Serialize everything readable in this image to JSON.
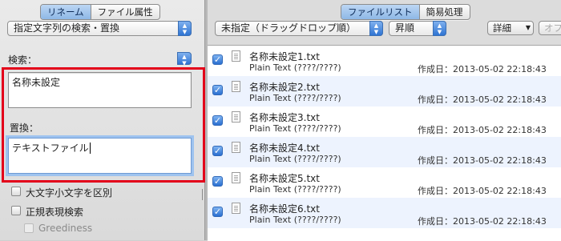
{
  "left": {
    "tabs": [
      "リネーム",
      "ファイル属性"
    ],
    "mode_popup": "指定文字列の検索・置換",
    "search_label": "検索：",
    "search_value": "名称未設定",
    "replace_label": "置換：",
    "replace_value": "テキストファイル",
    "checkboxes": {
      "case": "大文字小文字を区別",
      "regex": "正規表現検索",
      "greedy": "Greediness"
    }
  },
  "right": {
    "tabs": [
      "ファイルリスト",
      "簡易処理"
    ],
    "sort_popup": "未指定（ドラッグドロップ順）",
    "order_popup": "昇順",
    "detail_button": "詳細",
    "off_button": "オフ",
    "files": [
      {
        "name": "名称未設定1.txt",
        "type": "Plain Text (????/????)",
        "date": "作成日：2013-05-02 22:18:43"
      },
      {
        "name": "名称未設定2.txt",
        "type": "Plain Text (????/????)",
        "date": "作成日：2013-05-02 22:18:43"
      },
      {
        "name": "名称未設定3.txt",
        "type": "Plain Text (????/????)",
        "date": "作成日：2013-05-02 22:18:43"
      },
      {
        "name": "名称未設定4.txt",
        "type": "Plain Text (????/????)",
        "date": "作成日：2013-05-02 22:18:43"
      },
      {
        "name": "名称未設定5.txt",
        "type": "Plain Text (????/????)",
        "date": "作成日：2013-05-02 22:18:43"
      },
      {
        "name": "名称未設定6.txt",
        "type": "Plain Text (????/????)",
        "date": "作成日：2013-05-02 22:18:43"
      }
    ]
  },
  "colors": {
    "highlight_box": "#e3001a",
    "accent": "#2f74d3"
  }
}
